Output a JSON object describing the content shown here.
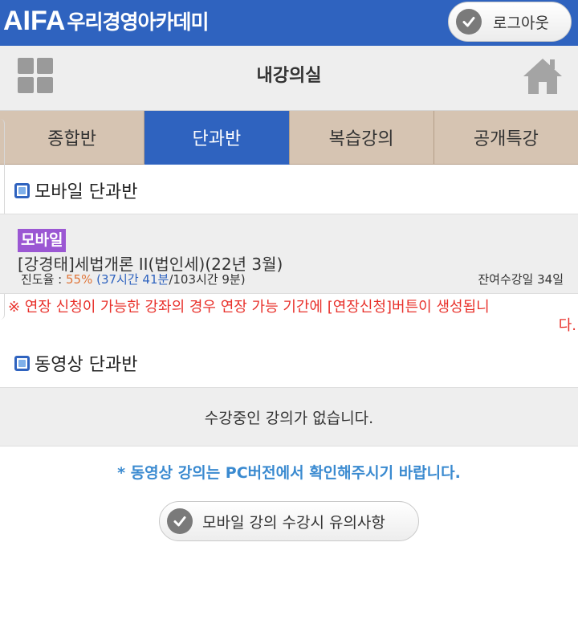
{
  "header": {
    "brand_logo": "AIFA",
    "brand_name": "우리경영아카데미",
    "logout_label": "로그아웃",
    "brand_color": "#2f63bf"
  },
  "titlebar": {
    "title": "내강의실",
    "menu_icon": "grid-icon",
    "home_icon": "home-icon"
  },
  "tabs": [
    {
      "label": "종합반",
      "active": false
    },
    {
      "label": "단과반",
      "active": true
    },
    {
      "label": "복습강의",
      "active": false
    },
    {
      "label": "공개특강",
      "active": false
    }
  ],
  "mobile_section": {
    "title": "모바일 단과반",
    "course": {
      "badge": "모바일",
      "name": "[강경태]세법개론 II(법인세)(22년 3월)",
      "progress_label": "진도율 : ",
      "progress_pct": "55%",
      "progress_open": " (",
      "progress_watched": "37시간 41분",
      "progress_total": "/103시간 9분)",
      "remaining": "잔여수강일 34일"
    },
    "extension_notice_line1": "※ 연장 신청이 가능한 강좌의 경우 연장 가능 기간에 [연장신청]버튼이 생성됩니",
    "extension_notice_line2": "다."
  },
  "video_section": {
    "title": "동영상 단과반",
    "empty_message": "수강중인 강의가 없습니다."
  },
  "pc_notice": "* 동영상 강의는 PC버전에서 확인해주시기 바랍니다.",
  "caution_button_label": "모바일 강의 수강시 유의사항",
  "colors": {
    "tab_inactive": "#d6c4b2",
    "tab_active": "#2f63bf",
    "badge": "#9b57d3",
    "notice_red": "#e8302a",
    "notice_blue": "#3a8ad0",
    "progress_pct": "#e0763a"
  }
}
